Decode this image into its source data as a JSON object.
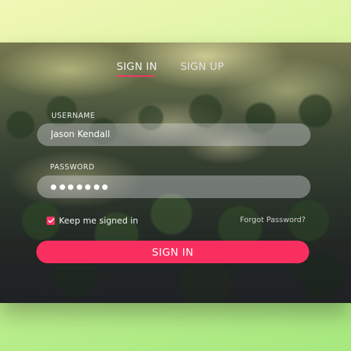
{
  "tabs": {
    "sign_in": "SIGN IN",
    "sign_up": "SIGN UP",
    "active": "sign_in"
  },
  "form": {
    "username_label": "USERNAME",
    "username_value": "Jason Kendall",
    "password_label": "PASSWORD",
    "password_masked_length": 7,
    "keep_signed_in_label": "Keep me signed in",
    "keep_signed_in_checked": true,
    "forgot_password": "Forgot Password?",
    "submit_label": "SIGN IN"
  },
  "colors": {
    "accent": "#f9305f",
    "input_bg": "rgba(220,220,225,0.40)",
    "text": "#ffffff"
  },
  "icons": {
    "checkbox": "checkmark-icon"
  }
}
